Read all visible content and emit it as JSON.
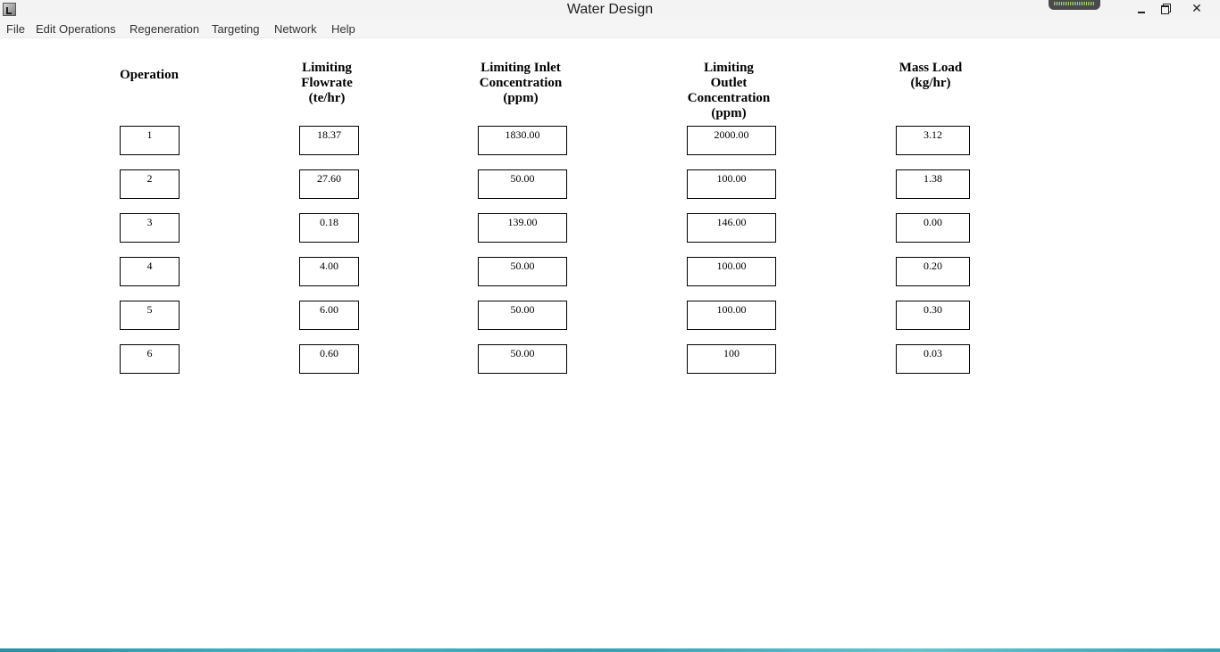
{
  "window": {
    "title": "Water Design",
    "icon": "app-chart-icon"
  },
  "menu": {
    "items": [
      "File",
      "Edit Operations",
      "Regeneration",
      "Targeting",
      "Network",
      "Help"
    ]
  },
  "table": {
    "headers": {
      "operation": "Operation",
      "flowrate": "Limiting\nFlowrate\n(te/hr)",
      "inlet": "Limiting Inlet\nConcentration\n(ppm)",
      "outlet": "Limiting\nOutlet\nConcentration\n(ppm)",
      "massload": "Mass Load\n(kg/hr)"
    },
    "rows": [
      {
        "operation": "1",
        "flowrate": "18.37",
        "inlet": "1830.00",
        "outlet": "2000.00",
        "massload": "3.12"
      },
      {
        "operation": "2",
        "flowrate": "27.60",
        "inlet": "50.00",
        "outlet": "100.00",
        "massload": "1.38"
      },
      {
        "operation": "3",
        "flowrate": "0.18",
        "inlet": "139.00",
        "outlet": "146.00",
        "massload": "0.00"
      },
      {
        "operation": "4",
        "flowrate": "4.00",
        "inlet": "50.00",
        "outlet": "100.00",
        "massload": "0.20"
      },
      {
        "operation": "5",
        "flowrate": "6.00",
        "inlet": "50.00",
        "outlet": "100.00",
        "massload": "0.30"
      },
      {
        "operation": "6",
        "flowrate": "0.60",
        "inlet": "50.00",
        "outlet": "100",
        "massload": "0.03"
      }
    ]
  }
}
